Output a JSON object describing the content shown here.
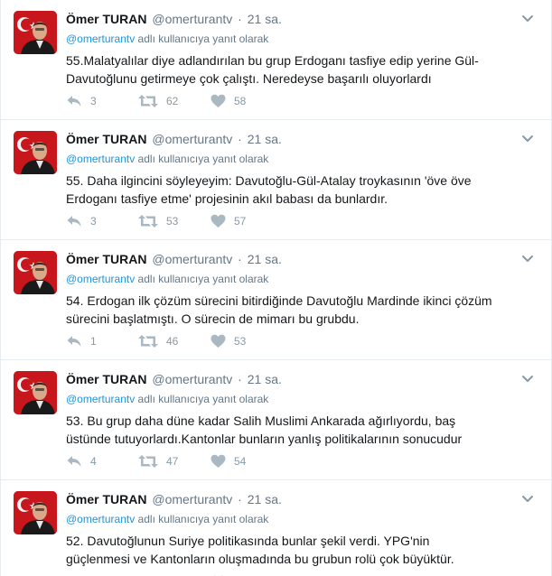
{
  "tweets": [
    {
      "fullname": "Ömer TURAN",
      "username": "@omerturantv",
      "dot": "·",
      "time": "21 sa.",
      "mention": "@omerturantv",
      "reply_suffix": " adlı kullanıcıya yanıt olarak",
      "text": "55.Malatyalılar diye adlandırılan bu grup Erdoganı tasfiye edip yerine Gül-Davutoğlunu getirmeye çok çalıştı. Neredeyse başarılı oluyorlardı",
      "replies": "3",
      "retweets": "62",
      "likes": "58"
    },
    {
      "fullname": "Ömer TURAN",
      "username": "@omerturantv",
      "dot": "·",
      "time": "21 sa.",
      "mention": "@omerturantv",
      "reply_suffix": " adlı kullanıcıya yanıt olarak",
      "text": "55. Daha ilgincini söyleyeyim: Davutoğlu-Gül-Atalay troykasının 'öve öve Erdoganı tasfiye etme' projesinin akıl babası da bunlardır.",
      "replies": "3",
      "retweets": "53",
      "likes": "57"
    },
    {
      "fullname": "Ömer TURAN",
      "username": "@omerturantv",
      "dot": "·",
      "time": "21 sa.",
      "mention": "@omerturantv",
      "reply_suffix": " adlı kullanıcıya yanıt olarak",
      "text": "54. Erdogan ilk çözüm sürecini bitirdiğinde Davutoğlu Mardinde ikinci çözüm sürecini başlatmıştı. O sürecin de mimarı bu grubdu.",
      "replies": "1",
      "retweets": "46",
      "likes": "53"
    },
    {
      "fullname": "Ömer TURAN",
      "username": "@omerturantv",
      "dot": "·",
      "time": "21 sa.",
      "mention": "@omerturantv",
      "reply_suffix": " adlı kullanıcıya yanıt olarak",
      "text": "53. Bu grup daha düne kadar Salih Muslimi Ankarada ağırlıyordu, baş üstünde tutuyorlardı.Kantonlar bunların yanlış politikalarının sonucudur",
      "replies": "4",
      "retweets": "47",
      "likes": "54"
    },
    {
      "fullname": "Ömer TURAN",
      "username": "@omerturantv",
      "dot": "·",
      "time": "21 sa.",
      "mention": "@omerturantv",
      "reply_suffix": " adlı kullanıcıya yanıt olarak",
      "text": "52. Davutoğlunun Suriye politikasında bunlar şekil verdi. YPG'nin güçlenmesi ve Kantonların oluşmadında bu grubun rolü çok büyüktür.",
      "replies": "",
      "retweets": "",
      "likes": ""
    }
  ],
  "icons": {
    "reply": "reply-icon",
    "retweet": "retweet-icon",
    "like": "heart-icon",
    "menu": "chevron-down-icon",
    "avatar": "avatar"
  },
  "colors": {
    "secondary_text": "#657786",
    "link": "#1b95e0",
    "action_icon": "#aab8c2",
    "divider": "#e6ecf0"
  }
}
